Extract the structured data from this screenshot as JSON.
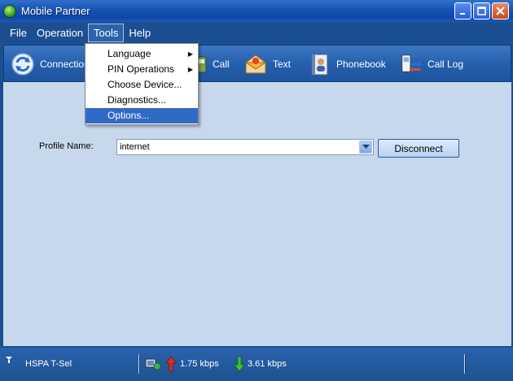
{
  "window": {
    "title": "Mobile Partner"
  },
  "menu": {
    "file": "File",
    "operation": "Operation",
    "tools": "Tools",
    "help": "Help"
  },
  "toolbar": {
    "connection": "Connection",
    "call": "Call",
    "text": "Text",
    "phonebook": "Phonebook",
    "call_log": "Call Log"
  },
  "tools_menu": {
    "items": [
      "Language",
      "PIN Operations",
      "Choose Device...",
      "Diagnostics...",
      "Options..."
    ],
    "selected": "Options..."
  },
  "profile": {
    "label": "Profile Name:",
    "value": "internet",
    "action": "Disconnect"
  },
  "status": {
    "network": "HSPA  T-Sel",
    "upload": "1.75 kbps",
    "download": "3.61 kbps"
  },
  "colors": {
    "frame": "#1b4f91",
    "main_bg": "#c7d8ec",
    "menu_highlight": "#316ac5"
  }
}
